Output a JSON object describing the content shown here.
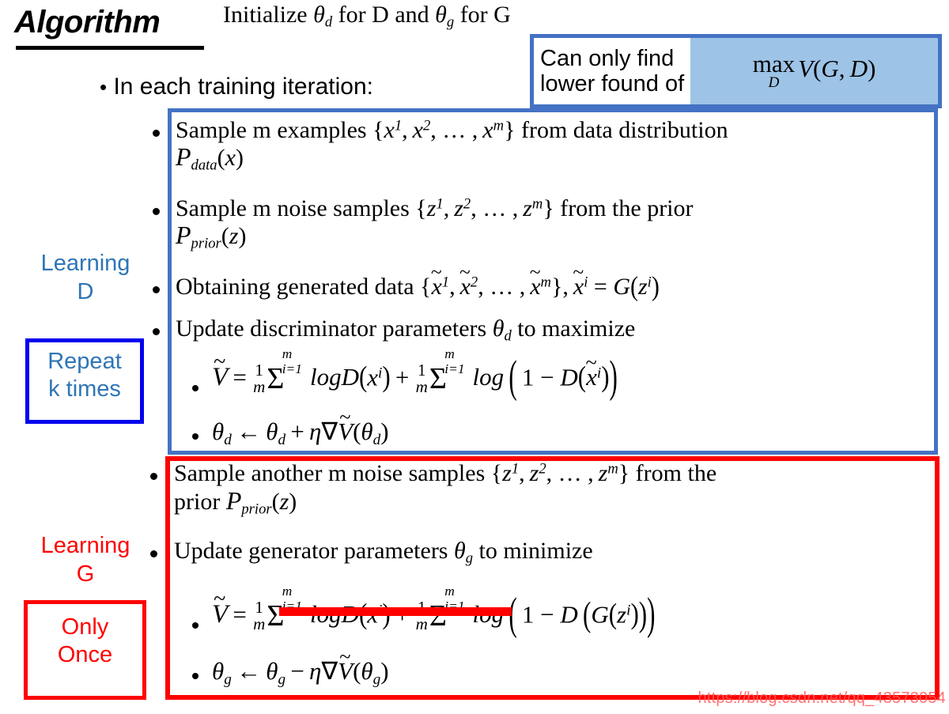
{
  "slide": {
    "title": "Algorithm",
    "init_line": "Initialize θd for D and θg for G",
    "iteration_line": "In each training iteration:",
    "watermark": "https://blog.csdn.net/qq_43573054"
  },
  "callout": {
    "text": "Can only find\nlower found of",
    "formula": "max_D V(G, D)",
    "border_color": "#4472c4",
    "formula_bg": "#9dc3e6"
  },
  "labels": {
    "learning_d": "Learning\nD",
    "repeat_k": "Repeat\nk times",
    "learning_g": "Learning\nG",
    "only_once": "Only\nOnce",
    "learning_d_color": "#2e75b6",
    "repeat_k_border": "#0000ee",
    "learning_g_color": "#ff0000",
    "only_once_border": "#ff0000"
  },
  "blue_section": {
    "border_color": "#4472c4",
    "steps": [
      {
        "id": "sample-m-examples",
        "line1": "Sample m examples {x¹, x², … , xᵐ} from data distribution",
        "line2": "P_data(x)"
      },
      {
        "id": "sample-m-noise",
        "line1": "Sample m noise samples {z¹, z², … , zᵐ} from the prior",
        "line2": "P_prior(z)"
      },
      {
        "id": "obtaining-generated-data",
        "line1": "Obtaining generated data {x̃¹, x̃², … , x̃ᵐ}, x̃ⁱ = G(zⁱ)"
      },
      {
        "id": "update-discriminator",
        "line1": "Update discriminator parameters θd to maximize"
      }
    ],
    "formulas": [
      {
        "id": "discriminator-objective",
        "latex": "Ṽ = (1/m) Σ_{i=1}^{m} logD(xⁱ) + (1/m) Σ_{i=1}^{m} log(1 − D(x̃ⁱ))"
      },
      {
        "id": "discriminator-update",
        "latex": "θd ← θd + η∇Ṽ(θd)"
      }
    ]
  },
  "red_section": {
    "border_color": "#ff0000",
    "steps": [
      {
        "id": "sample-another-m-noise",
        "line1": "Sample another m noise samples {z¹, z², … , zᵐ} from the",
        "line2": "prior P_prior(z)"
      },
      {
        "id": "update-generator",
        "line1": "Update generator parameters θg to minimize"
      }
    ],
    "formulas": [
      {
        "id": "generator-objective",
        "latex": "Ṽ = [struck out: (1/m) Σ_{i=1}^{m} logD(xⁱ)] + (1/m) Σ_{i=1}^{m} log(1 − D(G(zⁱ)))",
        "strikethrough": true,
        "strike_color": "#ff0000"
      },
      {
        "id": "generator-update",
        "latex": "θg ← θg − η∇Ṽ(θg)"
      }
    ]
  },
  "glyphs": {
    "theta": "θ",
    "eta": "η",
    "nabla": "∇",
    "sigma": "Σ",
    "arrow_left": "←",
    "minus": "−",
    "ellipsis": "…"
  }
}
